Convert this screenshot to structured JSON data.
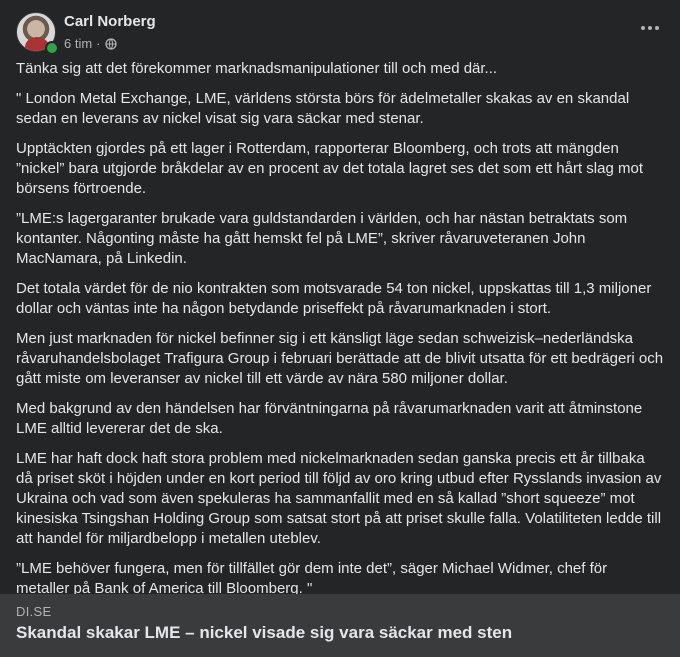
{
  "post": {
    "author": "Carl Norberg",
    "time": "6 tim",
    "separator": "·",
    "privacy_icon": "globe-icon",
    "more_icon": "more-horizontal-icon",
    "paragraphs": [
      "Tänka sig att det förekommer marknadsmanipulationer till och med där...",
      "\" London Metal Exchange, LME, världens största börs för ädelmetaller skakas av en skandal sedan en leverans av nickel visat sig vara säckar med stenar.",
      "Upptäckten gjordes på ett lager i Rotterdam, rapporterar Bloomberg, och trots att mängden ”nickel” bara utgjorde bråkdelar av en procent av det totala lagret ses det som ett hårt slag mot börsens förtroende.",
      "”LME:s lagergaranter brukade vara guldstandarden i världen, och har nästan betraktats som kontanter. Någonting måste ha gått hemskt fel på LME”, skriver råvaruveteranen John MacNamara, på Linkedin.",
      "Det totala värdet för de nio kontrakten som motsvarade 54 ton nickel, uppskattas till 1,3 miljoner dollar och väntas inte ha någon betydande priseffekt på råvarumarknaden i stort.",
      "Men just marknaden för nickel befinner sig i ett känsligt läge sedan schweizisk–nederländska råvaruhandelsbolaget Trafigura Group i februari berättade att de blivit utsatta för ett bedrägeri och gått miste om leveranser av nickel till ett värde av nära 580 miljoner dollar.",
      "Med bakgrund av den händelsen har förväntningarna på råvarumarknaden varit att åtminstone LME alltid levererar det de ska.",
      "LME har haft dock haft stora problem med nickelmarknaden sedan ganska precis ett år tillbaka då priset sköt i höjden under en kort period till följd av oro kring utbud efter Rysslands invasion av Ukraina och vad som även spekuleras ha sammanfallit med en så kallad ”short squeeze” mot kinesiska Tsingshan Holding Group som satsat stort på att priset skulle falla. Volatiliteten ledde till att handel för miljardbelopp i metallen uteblev.",
      "”LME behöver fungera, men för tillfället gör dem inte det”, säger Michael Widmer, chef för metaller på Bank of America till Bloomberg. \""
    ]
  },
  "link": {
    "domain": "DI.SE",
    "title": "Skandal skakar LME – nickel visade sig vara säckar med sten"
  },
  "colors": {
    "background": "#242526",
    "card": "#3a3b3c",
    "text": "#e4e6eb",
    "secondary": "#b0b3b8",
    "online": "#31a24c"
  }
}
